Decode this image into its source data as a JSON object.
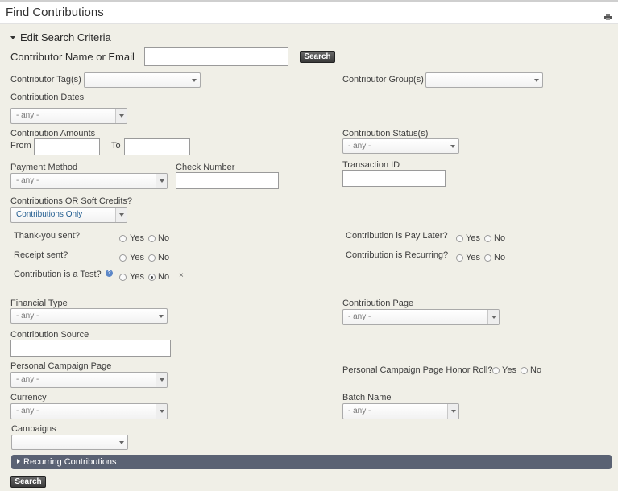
{
  "header": {
    "title": "Find Contributions",
    "print_icon": "print-icon"
  },
  "criteria": {
    "section_title": "Edit Search Criteria",
    "contributor_name_label": "Contributor Name or Email",
    "contributor_name_value": "",
    "search_label": "Search",
    "contributor_tags_label": "Contributor Tag(s)",
    "contributor_tags_value": "",
    "contributor_group_label": "Contributor Group(s)",
    "contributor_group_value": "",
    "contribution_dates_label": "Contribution Dates",
    "contribution_dates_value": "- any -",
    "contribution_amounts_label": "Contribution Amounts",
    "from_label": "From",
    "to_label": "To",
    "contribution_status_label": "Contribution Status(s)",
    "contribution_status_value": "- any -",
    "payment_method_label": "Payment Method",
    "payment_method_value": "- any -",
    "check_number_label": "Check Number",
    "transaction_id_label": "Transaction ID",
    "soft_credits_label": "Contributions OR Soft Credits?",
    "soft_credits_value": "Contributions Only",
    "thankyou_label": "Thank-you sent?",
    "receipt_label": "Receipt sent?",
    "is_test_label": "Contribution is a Test?",
    "pay_later_label": "Contribution is Pay Later?",
    "recurring_label": "Contribution is Recurring?",
    "yes_label": "Yes",
    "no_label": "No",
    "clear_label": "×",
    "financial_type_label": "Financial Type",
    "financial_type_value": "- any -",
    "contribution_page_label": "Contribution Page",
    "contribution_page_value": "- any -",
    "contribution_source_label": "Contribution Source",
    "pcp_label": "Personal Campaign Page",
    "pcp_value": "- any -",
    "pcp_honor_label": "Personal Campaign Page Honor Roll?",
    "currency_label": "Currency",
    "currency_value": "- any -",
    "batch_name_label": "Batch Name",
    "batch_name_value": "- any -",
    "campaigns_label": "Campaigns",
    "campaigns_value": "",
    "is_test_selected": "No"
  },
  "recurring": {
    "label": "Recurring Contributions"
  },
  "footer": {
    "search_label": "Search"
  }
}
